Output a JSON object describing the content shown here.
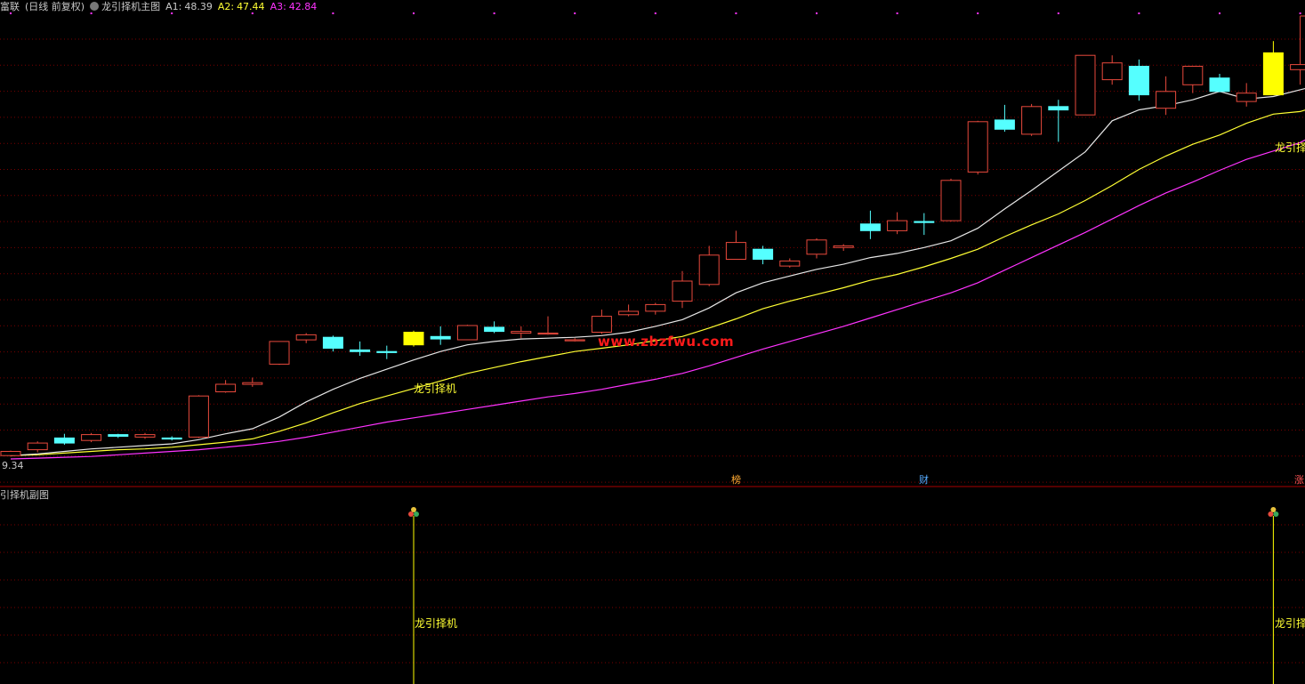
{
  "header": {
    "stock_name": "富联",
    "period_label": "(日线 前复权)",
    "indicator_name": "龙引择机主图",
    "ma_readouts": [
      {
        "label": "A1:",
        "value": "48.39",
        "color": "#c8c8c8"
      },
      {
        "label": "A2:",
        "value": "47.44",
        "color": "#ffff33"
      },
      {
        "label": "A3:",
        "value": "42.84",
        "color": "#ff33ff"
      }
    ]
  },
  "sub_panel": {
    "title": "引择机副图"
  },
  "price_label": "9.34",
  "watermark": "www.zbzfwu.com",
  "signal_label": "龙引择机",
  "event_badges": [
    {
      "text": "榜",
      "color": "#ffaa33"
    },
    {
      "text": "财",
      "color": "#55aaff"
    },
    {
      "text": "涨",
      "color": "#ff5555"
    }
  ],
  "colors": {
    "up": "#e8493c",
    "down": "#55ffff",
    "signal": "#ffff00",
    "ma1": "#e6e6e6",
    "ma2": "#ffff33",
    "ma3": "#ff33ff",
    "grid": "#7a0000",
    "divider": "#aa0000"
  },
  "chart_data": {
    "type": "candlestick",
    "ylim": [
      9.0,
      62.0
    ],
    "candles": [
      {
        "o": 9.4,
        "c": 9.9,
        "h": 10.0,
        "l": 9.3
      },
      {
        "o": 10.1,
        "c": 10.9,
        "h": 11.1,
        "l": 9.8
      },
      {
        "o": 11.5,
        "c": 10.9,
        "h": 12.0,
        "l": 10.7
      },
      {
        "o": 11.2,
        "c": 11.9,
        "h": 12.1,
        "l": 11.0
      },
      {
        "o": 11.9,
        "c": 11.7,
        "h": 12.0,
        "l": 11.5
      },
      {
        "o": 11.6,
        "c": 11.9,
        "h": 12.1,
        "l": 11.4
      },
      {
        "o": 11.5,
        "c": 11.4,
        "h": 11.7,
        "l": 11.2
      },
      {
        "o": 11.6,
        "c": 16.5,
        "h": 16.6,
        "l": 11.5
      },
      {
        "o": 17.0,
        "c": 17.9,
        "h": 18.4,
        "l": 16.9
      },
      {
        "o": 17.9,
        "c": 18.1,
        "h": 18.7,
        "l": 17.6
      },
      {
        "o": 20.3,
        "c": 23.0,
        "h": 23.0,
        "l": 20.2
      },
      {
        "o": 23.2,
        "c": 23.8,
        "h": 24.0,
        "l": 22.8
      },
      {
        "o": 23.5,
        "c": 22.2,
        "h": 23.7,
        "l": 21.8
      },
      {
        "o": 22.0,
        "c": 21.8,
        "h": 23.0,
        "l": 21.3
      },
      {
        "o": 21.8,
        "c": 21.7,
        "h": 22.5,
        "l": 20.9
      },
      {
        "o": 22.6,
        "c": 24.1,
        "h": 24.3,
        "l": 22.4,
        "signal": true
      },
      {
        "o": 23.6,
        "c": 23.3,
        "h": 24.8,
        "l": 22.6
      },
      {
        "o": 23.2,
        "c": 24.9,
        "h": 25.0,
        "l": 23.2
      },
      {
        "o": 24.7,
        "c": 24.2,
        "h": 25.4,
        "l": 24.0
      },
      {
        "o": 24.0,
        "c": 24.2,
        "h": 24.8,
        "l": 23.4
      },
      {
        "o": 24.0,
        "c": 24.0,
        "h": 26.0,
        "l": 23.8
      },
      {
        "o": 23.2,
        "c": 23.2,
        "h": 23.4,
        "l": 23.0
      },
      {
        "o": 24.1,
        "c": 26.0,
        "h": 26.8,
        "l": 23.9
      },
      {
        "o": 26.2,
        "c": 26.6,
        "h": 27.4,
        "l": 26.0
      },
      {
        "o": 26.6,
        "c": 27.4,
        "h": 27.6,
        "l": 26.2
      },
      {
        "o": 27.8,
        "c": 30.2,
        "h": 31.4,
        "l": 27.0
      },
      {
        "o": 29.8,
        "c": 33.3,
        "h": 34.4,
        "l": 29.6
      },
      {
        "o": 32.8,
        "c": 34.8,
        "h": 36.2,
        "l": 32.8
      },
      {
        "o": 34.0,
        "c": 32.8,
        "h": 34.4,
        "l": 32.2
      },
      {
        "o": 32.0,
        "c": 32.6,
        "h": 32.9,
        "l": 31.8
      },
      {
        "o": 33.4,
        "c": 35.1,
        "h": 35.3,
        "l": 32.9
      },
      {
        "o": 34.2,
        "c": 34.4,
        "h": 34.6,
        "l": 33.8
      },
      {
        "o": 37.0,
        "c": 36.2,
        "h": 38.6,
        "l": 35.2
      },
      {
        "o": 36.2,
        "c": 37.4,
        "h": 38.4,
        "l": 35.8
      },
      {
        "o": 37.3,
        "c": 37.2,
        "h": 38.3,
        "l": 35.7
      },
      {
        "o": 37.4,
        "c": 42.2,
        "h": 42.4,
        "l": 37.3
      },
      {
        "o": 43.2,
        "c": 49.2,
        "h": 49.3,
        "l": 42.9
      },
      {
        "o": 49.4,
        "c": 48.3,
        "h": 51.2,
        "l": 48.0
      },
      {
        "o": 47.7,
        "c": 51.0,
        "h": 51.3,
        "l": 47.5
      },
      {
        "o": 51.0,
        "c": 50.6,
        "h": 51.8,
        "l": 46.8
      },
      {
        "o": 50.0,
        "c": 57.1,
        "h": 57.1,
        "l": 50.0
      },
      {
        "o": 54.2,
        "c": 56.2,
        "h": 57.1,
        "l": 53.6
      },
      {
        "o": 55.8,
        "c": 52.4,
        "h": 56.6,
        "l": 51.7
      },
      {
        "o": 50.8,
        "c": 52.8,
        "h": 54.6,
        "l": 50.0
      },
      {
        "o": 53.6,
        "c": 55.8,
        "h": 55.8,
        "l": 52.6
      },
      {
        "o": 54.4,
        "c": 52.8,
        "h": 54.9,
        "l": 52.7
      },
      {
        "o": 51.6,
        "c": 52.6,
        "h": 53.8,
        "l": 51.0
      },
      {
        "o": 52.4,
        "c": 57.4,
        "h": 58.8,
        "l": 52.4,
        "signal": true
      },
      {
        "o": 55.4,
        "c": 56.0,
        "h": 61.8,
        "l": 53.6
      }
    ],
    "ma1": [
      9.4,
      9.6,
      9.9,
      10.2,
      10.4,
      10.6,
      10.8,
      11.3,
      12.0,
      12.6,
      14.0,
      15.8,
      17.3,
      18.6,
      19.7,
      20.8,
      21.8,
      22.6,
      23.0,
      23.3,
      23.4,
      23.5,
      23.7,
      24.1,
      24.8,
      25.6,
      27.0,
      28.8,
      30.0,
      30.8,
      31.6,
      32.2,
      33.0,
      33.5,
      34.2,
      35.0,
      36.5,
      38.8,
      41.0,
      43.3,
      45.6,
      49.3,
      50.6,
      51.1,
      51.8,
      52.8,
      51.9,
      52.2,
      53.0,
      53.8
    ],
    "ma2": [
      9.4,
      9.5,
      9.7,
      9.9,
      10.1,
      10.2,
      10.4,
      10.7,
      11.0,
      11.4,
      12.3,
      13.3,
      14.5,
      15.6,
      16.5,
      17.4,
      18.3,
      19.2,
      19.9,
      20.6,
      21.2,
      21.8,
      22.2,
      22.6,
      23.1,
      23.6,
      24.6,
      25.7,
      26.9,
      27.8,
      28.6,
      29.4,
      30.3,
      31.0,
      31.9,
      32.9,
      34.0,
      35.5,
      36.9,
      38.2,
      39.8,
      41.6,
      43.5,
      45.1,
      46.5,
      47.6,
      49.0,
      50.1,
      50.4,
      51.4
    ],
    "ma3": [
      9.0,
      9.1,
      9.2,
      9.3,
      9.5,
      9.7,
      9.9,
      10.1,
      10.4,
      10.7,
      11.1,
      11.6,
      12.2,
      12.8,
      13.4,
      13.9,
      14.4,
      14.9,
      15.4,
      15.9,
      16.4,
      16.8,
      17.3,
      17.9,
      18.5,
      19.2,
      20.1,
      21.1,
      22.1,
      23.0,
      23.9,
      24.8,
      25.8,
      26.8,
      27.8,
      28.8,
      30.0,
      31.5,
      33.0,
      34.5,
      36.0,
      37.6,
      39.2,
      40.7,
      42.0,
      43.4,
      44.7,
      45.7,
      46.7,
      48.4
    ]
  }
}
